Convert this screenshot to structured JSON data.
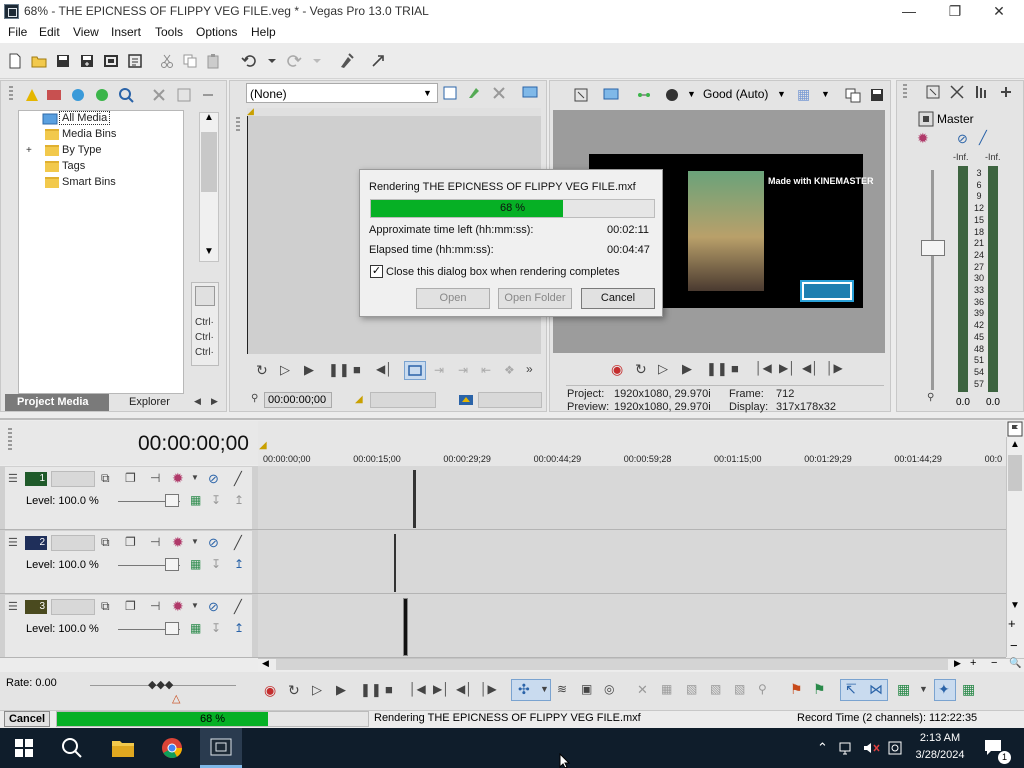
{
  "window": {
    "title": "68% - THE EPICNESS OF FLIPPY VEG FILE.veg * - Vegas Pro 13.0 TRIAL"
  },
  "menu": [
    "File",
    "Edit",
    "View",
    "Insert",
    "Tools",
    "Options",
    "Help"
  ],
  "project_media": {
    "tree": [
      "All Media",
      "Media Bins",
      "By Type",
      "Tags",
      "Smart Bins"
    ],
    "expander": "+",
    "tabs": [
      "Project Media",
      "Explorer"
    ],
    "ctrl_labels": [
      "Ctrl·",
      "Ctrl·",
      "Ctrl·"
    ]
  },
  "trimmer": {
    "selector_value": "(None)",
    "timecode": "00:00:00;00"
  },
  "preview": {
    "quality": "Good (Auto)",
    "watermark": "Made with KINEMASTER",
    "project_label": "Project:",
    "project_value": "1920x1080, 29.970i",
    "preview_label": "Preview:",
    "preview_value": "1920x1080, 29.970i",
    "frame_label": "Frame:",
    "frame_value": "712",
    "display_label": "Display:",
    "display_value": "317x178x32"
  },
  "master": {
    "title": "Master",
    "inf_left": "-Inf.",
    "inf_right": "-Inf.",
    "scale": [
      "3",
      "6",
      "9",
      "12",
      "15",
      "18",
      "21",
      "24",
      "27",
      "30",
      "33",
      "36",
      "39",
      "42",
      "45",
      "48",
      "51",
      "54",
      "57"
    ],
    "bottom_left": "0.0",
    "bottom_right": "0.0"
  },
  "render_dialog": {
    "title": "Rendering THE EPICNESS OF FLIPPY VEG FILE.mxf",
    "progress": 0.68,
    "progress_text": "68 %",
    "time_left_label": "Approximate time left (hh:mm:ss):",
    "time_left_value": "00:02:11",
    "elapsed_label": "Elapsed time (hh:mm:ss):",
    "elapsed_value": "00:04:47",
    "close_checkbox_label": "Close this dialog box when rendering completes",
    "close_checkbox_checked": true,
    "open_button": "Open",
    "open_folder_button": "Open Folder",
    "cancel_button": "Cancel"
  },
  "timeline": {
    "main_timecode": "00:00:00;00",
    "ruler": [
      "00:00:00;00",
      "00:00:15;00",
      "00:00:29;29",
      "00:00:44;29",
      "00:00:59;28",
      "00:01:15;00",
      "00:01:29;29",
      "00:01:44;29",
      "00:0"
    ],
    "tracks": [
      {
        "number": "1",
        "level": "Level: 100.0 %"
      },
      {
        "number": "2",
        "level": "Level: 100.0 %"
      },
      {
        "number": "3",
        "level": "Level: 100.0 %"
      }
    ],
    "rate": "Rate: 0.00"
  },
  "status": {
    "cancel_button": "Cancel",
    "progress": 0.68,
    "progress_text": "68 %",
    "rendering_text": "Rendering THE EPICNESS OF FLIPPY VEG FILE.mxf",
    "record_time": "Record Time (2 channels): 112:22:35"
  },
  "taskbar": {
    "time": "2:13 AM",
    "date": "3/28/2024",
    "notification_count": "1"
  },
  "colors": {
    "progress_green": "#06b025",
    "taskbar_bg": "#0f1d2b",
    "accent_blue": "#2f7bd8"
  }
}
